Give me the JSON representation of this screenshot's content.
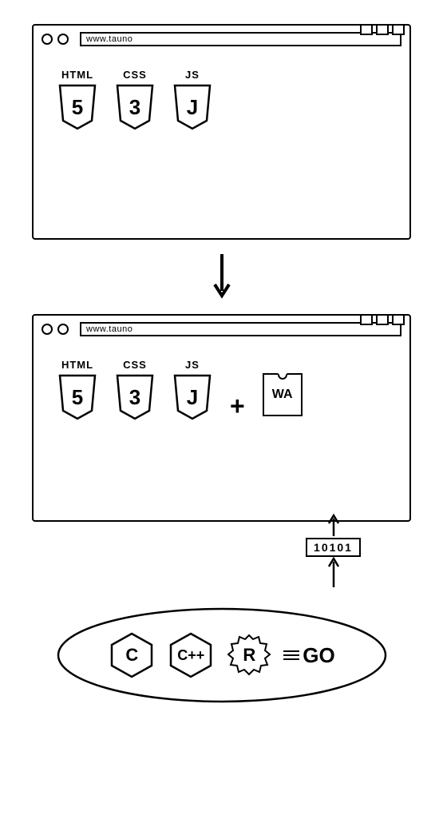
{
  "url": "www.tauno",
  "browser1": {
    "techs": [
      {
        "label": "HTML",
        "badge": "5"
      },
      {
        "label": "CSS",
        "badge": "3"
      },
      {
        "label": "JS",
        "badge": "J"
      }
    ]
  },
  "transition": {
    "direction": "down"
  },
  "browser2": {
    "techs": [
      {
        "label": "HTML",
        "badge": "5"
      },
      {
        "label": "CSS",
        "badge": "3"
      },
      {
        "label": "JS",
        "badge": "J"
      }
    ],
    "plus": "+",
    "wa": "WA"
  },
  "compile": {
    "binary": "10101"
  },
  "languages": {
    "c": "C",
    "cpp": "C++",
    "rust": "R",
    "go": "GO"
  }
}
